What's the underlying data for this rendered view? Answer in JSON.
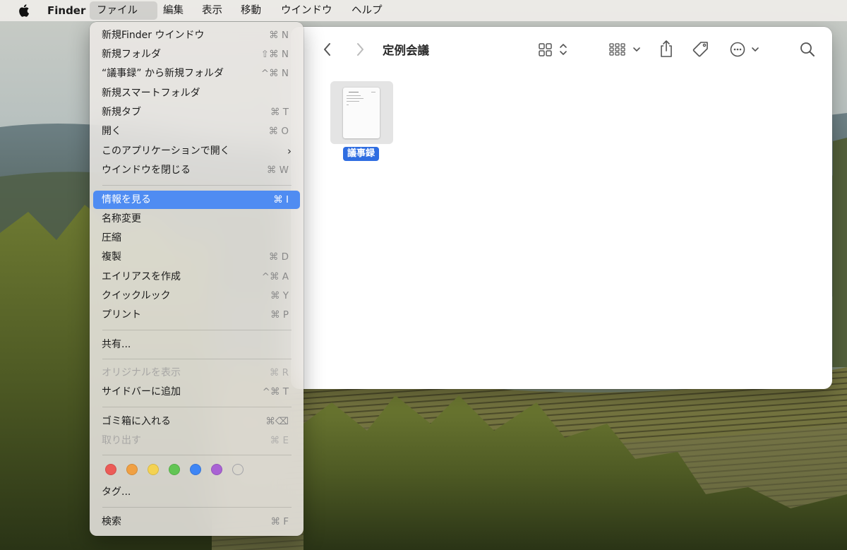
{
  "menubar": {
    "app_name": "Finder",
    "items": [
      "ファイル",
      "編集",
      "表示",
      "移動",
      "ウインドウ",
      "ヘルプ"
    ],
    "active_item": "ファイル"
  },
  "file_menu": {
    "groups": [
      [
        {
          "label": "新規Finder ウインドウ",
          "shortcut": "⌘ N"
        },
        {
          "label": "新規フォルダ",
          "shortcut": "⇧⌘ N"
        },
        {
          "label": "“議事録” から新規フォルダ",
          "shortcut": "^⌘ N"
        },
        {
          "label": "新規スマートフォルダ",
          "shortcut": ""
        },
        {
          "label": "新規タブ",
          "shortcut": "⌘ T"
        },
        {
          "label": "開く",
          "shortcut": "⌘ O"
        },
        {
          "label": "このアプリケーションで開く",
          "shortcut": "",
          "submenu": true
        },
        {
          "label": "ウインドウを閉じる",
          "shortcut": "⌘ W"
        }
      ],
      [
        {
          "label": "情報を見る",
          "shortcut": "⌘ I",
          "highlighted": true
        },
        {
          "label": "名称変更",
          "shortcut": ""
        },
        {
          "label": "圧縮",
          "shortcut": ""
        },
        {
          "label": "複製",
          "shortcut": "⌘ D"
        },
        {
          "label": "エイリアスを作成",
          "shortcut": "^⌘ A"
        },
        {
          "label": "クイックルック",
          "shortcut": "⌘ Y"
        },
        {
          "label": "プリント",
          "shortcut": "⌘ P"
        }
      ],
      [
        {
          "label": "共有...",
          "shortcut": ""
        }
      ],
      [
        {
          "label": "オリジナルを表示",
          "shortcut": "⌘ R",
          "disabled": true
        },
        {
          "label": "サイドバーに追加",
          "shortcut": "^⌘ T"
        }
      ],
      [
        {
          "label": "ゴミ箱に入れる",
          "shortcut": "⌘⌫"
        },
        {
          "label": "取り出す",
          "shortcut": "⌘ E",
          "disabled": true
        }
      ],
      [
        {
          "label": "タグ...",
          "shortcut": ""
        }
      ],
      [
        {
          "label": "検索",
          "shortcut": "⌘ F"
        }
      ]
    ],
    "tag_colors": [
      "#ec5b57",
      "#f0a043",
      "#f4d252",
      "#62c554",
      "#3e86f5",
      "#a962d4",
      "#a3a3a8"
    ]
  },
  "finder_window": {
    "title": "定例会議",
    "icons": {
      "back": "chevron-left-icon",
      "forward": "chevron-right-icon",
      "view": "icon-grid-icon",
      "group": "group-icon",
      "share": "share-icon",
      "tag": "tag-icon",
      "more": "ellipsis-circle-icon",
      "search": "magnifier-icon"
    },
    "files": [
      {
        "name": "議事録",
        "selected": true
      }
    ]
  }
}
